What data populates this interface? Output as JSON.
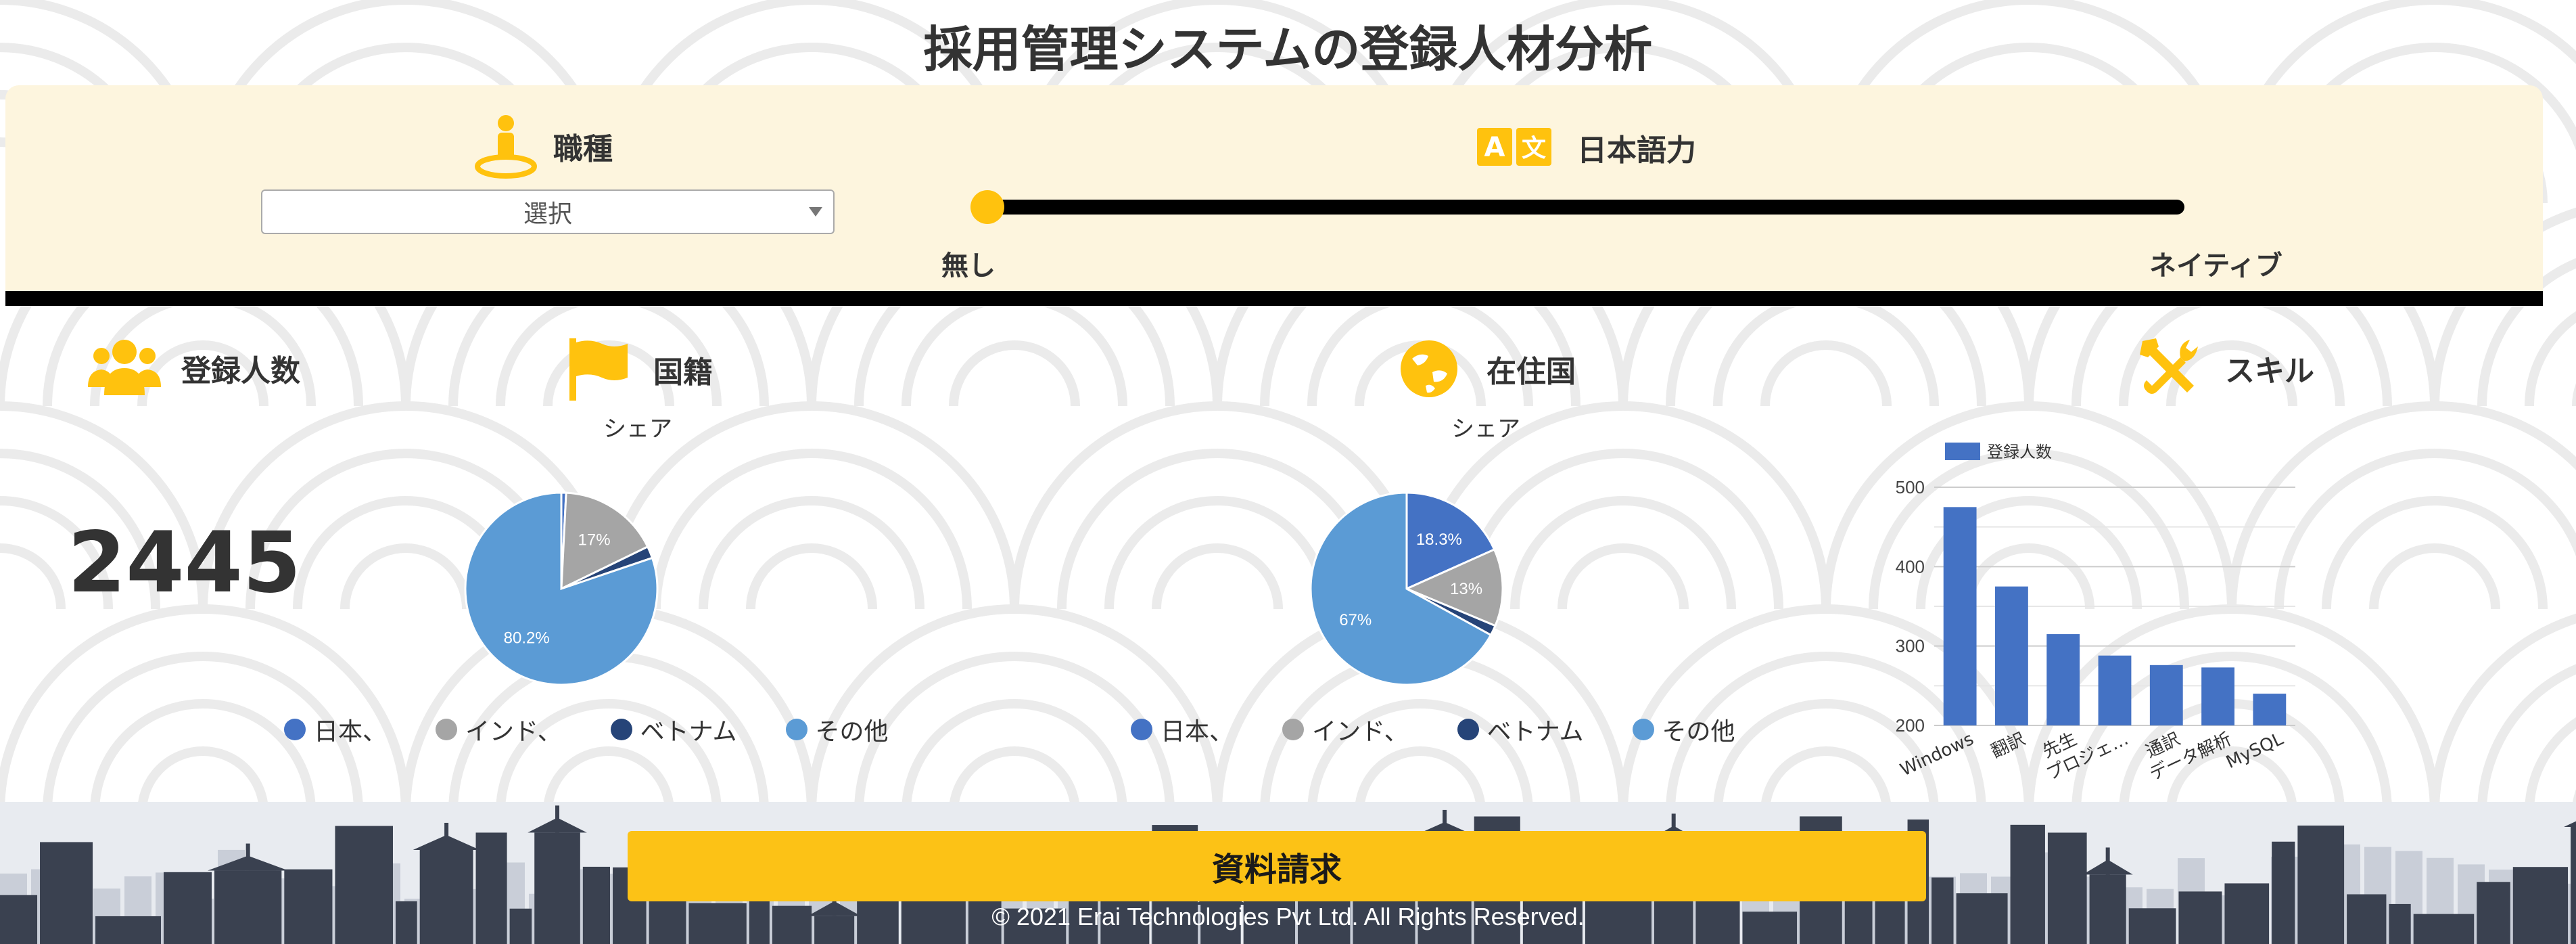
{
  "page": {
    "title": "採用管理システムの登録人材分析"
  },
  "filters": {
    "job_type": {
      "label": "職種",
      "icon": "person-icon",
      "select_value": "選択"
    },
    "japanese_level": {
      "label": "日本語力",
      "icon": "translate-icon",
      "min_label": "無し",
      "max_label": "ネイティブ",
      "value": 0
    }
  },
  "registered": {
    "label": "登録人数",
    "icon": "people-icon",
    "count": "2445"
  },
  "nationality": {
    "label": "国籍",
    "icon": "flag-icon",
    "chart_subtitle": "シェア",
    "legend": [
      "日本、",
      "インド、",
      "ベトナム",
      "その他"
    ]
  },
  "residence": {
    "label": "在住国",
    "icon": "globe-icon",
    "chart_subtitle": "シェア",
    "legend": [
      "日本、",
      "インド、",
      "ベトナム",
      "その他"
    ]
  },
  "skills": {
    "label": "スキル",
    "icon": "tools-icon"
  },
  "colors": {
    "accent": "#ffc20e",
    "japan": "#4472c4",
    "india": "#a5a5a5",
    "vietnam": "#264478",
    "other": "#5b9bd5",
    "bar": "#4472c4"
  },
  "chart_data": [
    {
      "type": "pie",
      "title": "シェア",
      "labels": [
        "日本、",
        "インド、",
        "ベトナム",
        "その他"
      ],
      "values": [
        0.8,
        17,
        2.0,
        80.2
      ],
      "data_labels": [
        "",
        "17%",
        "",
        "80.2%"
      ]
    },
    {
      "type": "pie",
      "title": "シェア",
      "labels": [
        "日本、",
        "インド、",
        "ベトナム",
        "その他"
      ],
      "values": [
        18.3,
        13,
        1.7,
        67
      ],
      "data_labels": [
        "18.3%",
        "13%",
        "",
        "67%"
      ]
    },
    {
      "type": "bar",
      "series": [
        {
          "name": "登録人数",
          "values": [
            475,
            375,
            315,
            288,
            276,
            273,
            240
          ]
        }
      ],
      "categories": [
        "Windows",
        "翻訳",
        "先生",
        "プロジェ…",
        "通訳",
        "データ解析",
        "MySQL"
      ],
      "ylim": [
        200,
        500
      ],
      "yticks": [
        200,
        300,
        400,
        500
      ],
      "grid": true,
      "legend": "top-left"
    }
  ],
  "footer": {
    "button_label": "資料請求",
    "copyright": "© 2021 Erai Technologies Pvt Ltd. All Rights Reserved."
  }
}
